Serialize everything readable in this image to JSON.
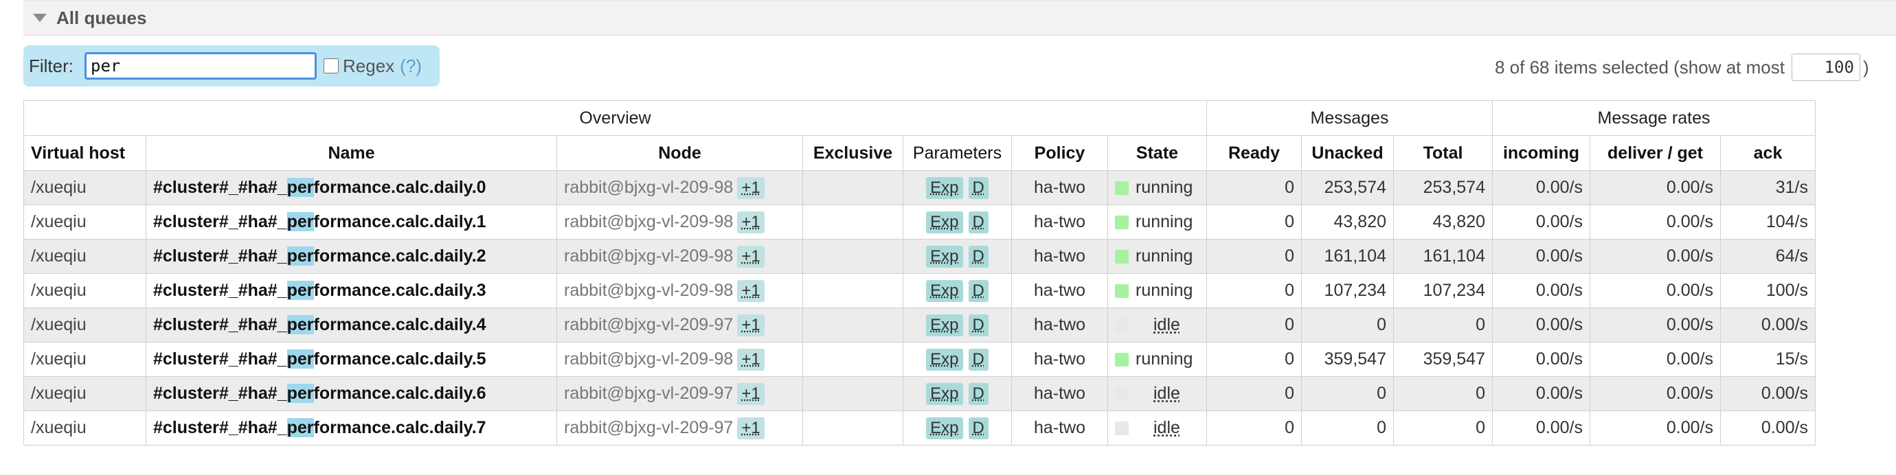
{
  "section": {
    "title": "All queues"
  },
  "filter": {
    "label": "Filter:",
    "value": "per",
    "regex_label": "Regex",
    "regex_help": "(?)"
  },
  "selection": {
    "prefix": "8 of 68 items selected (show at most",
    "max": "100",
    "suffix": ")"
  },
  "table": {
    "groups": {
      "overview": "Overview",
      "messages": "Messages",
      "rates": "Message rates"
    },
    "columns": {
      "vhost": "Virtual host",
      "name": "Name",
      "node": "Node",
      "exclusive": "Exclusive",
      "parameters": "Parameters",
      "policy": "Policy",
      "state": "State",
      "ready": "Ready",
      "unacked": "Unacked",
      "total": "Total",
      "incoming": "incoming",
      "deliver": "deliver / get",
      "ack": "ack"
    },
    "rows": [
      {
        "vhost": "/xueqiu",
        "name_pre": "#cluster#_#ha#_",
        "name_hl": "per",
        "name_post": "formance.calc.daily.0",
        "node": "rabbit@bjxg-vl-209-98",
        "node_extra": "+1",
        "exclusive": "",
        "param_exp": "Exp",
        "param_d": "D",
        "policy": "ha-two",
        "state": "running",
        "ready": "0",
        "unacked": "253,574",
        "total": "253,574",
        "incoming": "0.00/s",
        "deliver": "0.00/s",
        "ack": "31/s"
      },
      {
        "vhost": "/xueqiu",
        "name_pre": "#cluster#_#ha#_",
        "name_hl": "per",
        "name_post": "formance.calc.daily.1",
        "node": "rabbit@bjxg-vl-209-98",
        "node_extra": "+1",
        "exclusive": "",
        "param_exp": "Exp",
        "param_d": "D",
        "policy": "ha-two",
        "state": "running",
        "ready": "0",
        "unacked": "43,820",
        "total": "43,820",
        "incoming": "0.00/s",
        "deliver": "0.00/s",
        "ack": "104/s"
      },
      {
        "vhost": "/xueqiu",
        "name_pre": "#cluster#_#ha#_",
        "name_hl": "per",
        "name_post": "formance.calc.daily.2",
        "node": "rabbit@bjxg-vl-209-98",
        "node_extra": "+1",
        "exclusive": "",
        "param_exp": "Exp",
        "param_d": "D",
        "policy": "ha-two",
        "state": "running",
        "ready": "0",
        "unacked": "161,104",
        "total": "161,104",
        "incoming": "0.00/s",
        "deliver": "0.00/s",
        "ack": "64/s"
      },
      {
        "vhost": "/xueqiu",
        "name_pre": "#cluster#_#ha#_",
        "name_hl": "per",
        "name_post": "formance.calc.daily.3",
        "node": "rabbit@bjxg-vl-209-98",
        "node_extra": "+1",
        "exclusive": "",
        "param_exp": "Exp",
        "param_d": "D",
        "policy": "ha-two",
        "state": "running",
        "ready": "0",
        "unacked": "107,234",
        "total": "107,234",
        "incoming": "0.00/s",
        "deliver": "0.00/s",
        "ack": "100/s"
      },
      {
        "vhost": "/xueqiu",
        "name_pre": "#cluster#_#ha#_",
        "name_hl": "per",
        "name_post": "formance.calc.daily.4",
        "node": "rabbit@bjxg-vl-209-97",
        "node_extra": "+1",
        "exclusive": "",
        "param_exp": "Exp",
        "param_d": "D",
        "policy": "ha-two",
        "state": "idle",
        "ready": "0",
        "unacked": "0",
        "total": "0",
        "incoming": "0.00/s",
        "deliver": "0.00/s",
        "ack": "0.00/s"
      },
      {
        "vhost": "/xueqiu",
        "name_pre": "#cluster#_#ha#_",
        "name_hl": "per",
        "name_post": "formance.calc.daily.5",
        "node": "rabbit@bjxg-vl-209-98",
        "node_extra": "+1",
        "exclusive": "",
        "param_exp": "Exp",
        "param_d": "D",
        "policy": "ha-two",
        "state": "running",
        "ready": "0",
        "unacked": "359,547",
        "total": "359,547",
        "incoming": "0.00/s",
        "deliver": "0.00/s",
        "ack": "15/s"
      },
      {
        "vhost": "/xueqiu",
        "name_pre": "#cluster#_#ha#_",
        "name_hl": "per",
        "name_post": "formance.calc.daily.6",
        "node": "rabbit@bjxg-vl-209-97",
        "node_extra": "+1",
        "exclusive": "",
        "param_exp": "Exp",
        "param_d": "D",
        "policy": "ha-two",
        "state": "idle",
        "ready": "0",
        "unacked": "0",
        "total": "0",
        "incoming": "0.00/s",
        "deliver": "0.00/s",
        "ack": "0.00/s"
      },
      {
        "vhost": "/xueqiu",
        "name_pre": "#cluster#_#ha#_",
        "name_hl": "per",
        "name_post": "formance.calc.daily.7",
        "node": "rabbit@bjxg-vl-209-97",
        "node_extra": "+1",
        "exclusive": "",
        "param_exp": "Exp",
        "param_d": "D",
        "policy": "ha-two",
        "state": "idle",
        "ready": "0",
        "unacked": "0",
        "total": "0",
        "incoming": "0.00/s",
        "deliver": "0.00/s",
        "ack": "0.00/s"
      }
    ]
  }
}
